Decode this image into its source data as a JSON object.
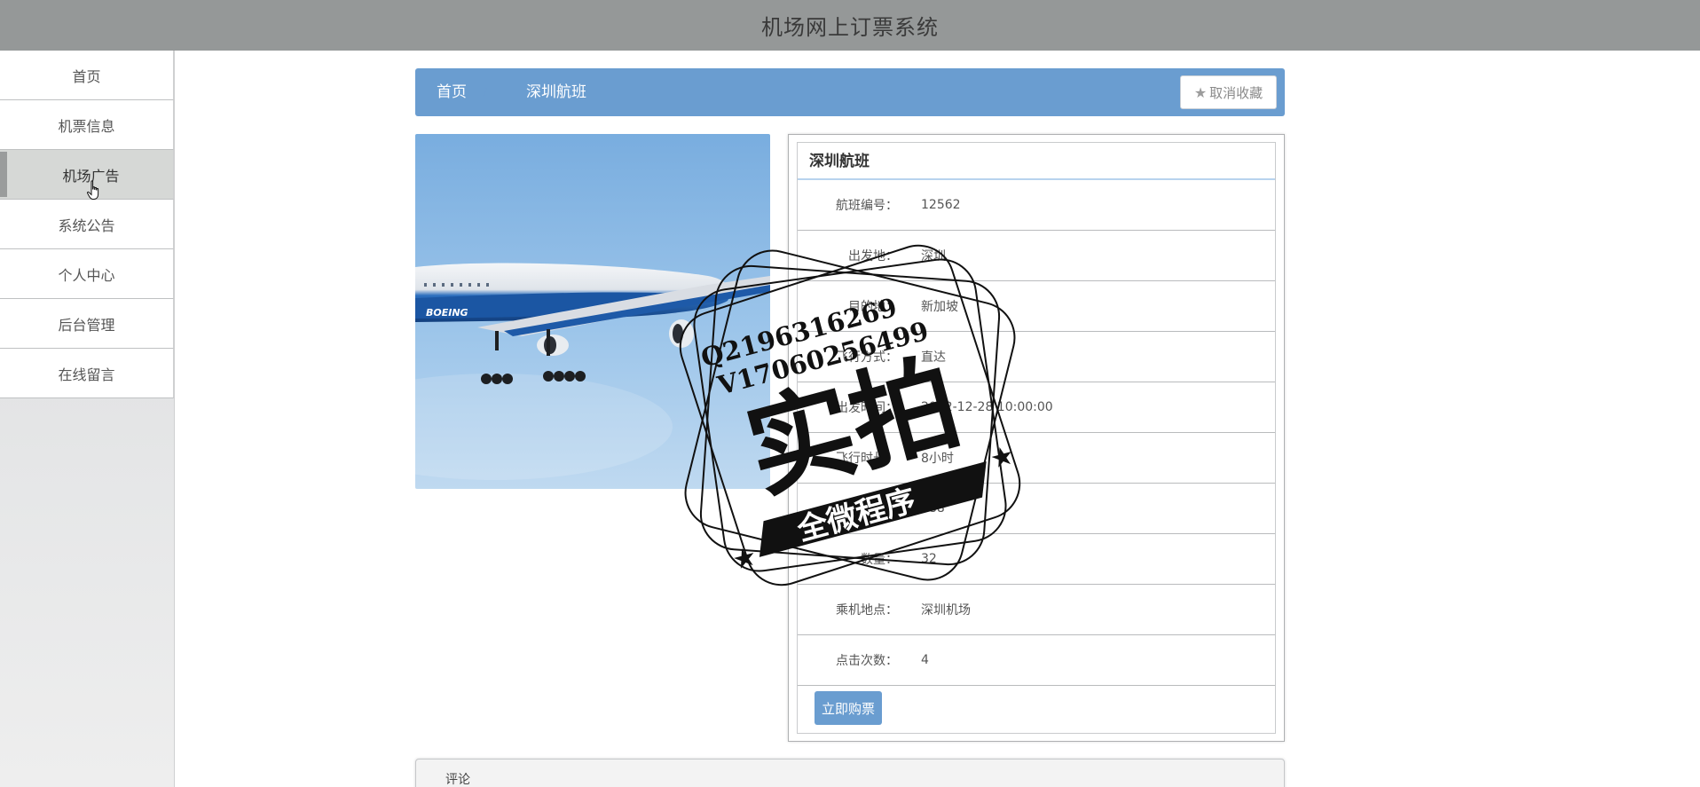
{
  "header": {
    "title": "机场网上订票系统"
  },
  "sidebar": {
    "items": [
      {
        "label": "首页"
      },
      {
        "label": "机票信息"
      },
      {
        "label": "机场广告",
        "active": true
      },
      {
        "label": "系统公告"
      },
      {
        "label": "个人中心"
      },
      {
        "label": "后台管理"
      },
      {
        "label": "在线留言"
      }
    ]
  },
  "breadcrumb": {
    "home": "首页",
    "current": "深圳航班"
  },
  "actions": {
    "unfavorite_label": "取消收藏"
  },
  "detail": {
    "title": "深圳航班",
    "rows": [
      {
        "label": "航班编号：",
        "value": "12562"
      },
      {
        "label": "出发地：",
        "value": "深圳"
      },
      {
        "label": "目的地：",
        "value": "新加坡"
      },
      {
        "label": "飞行方式：",
        "value": "直达"
      },
      {
        "label": "出发时间：",
        "value": "2022-12-28 10:00:00"
      },
      {
        "label": "飞行时长：",
        "value": "8小时"
      },
      {
        "label": "价格：",
        "value": "888"
      },
      {
        "label": "数量：",
        "value": "32"
      },
      {
        "label": "乘机地点：",
        "value": "深圳机场"
      },
      {
        "label": "点击次数：",
        "value": "4"
      }
    ],
    "buy_label": "立即购票"
  },
  "comments": {
    "label": "评论"
  },
  "watermark": {
    "line1": "Q2196316269",
    "line2": "V17060256499",
    "main": "实拍",
    "banner": "全微程序"
  },
  "colors": {
    "accent": "#6a9dd0",
    "topbar": "#959898"
  }
}
